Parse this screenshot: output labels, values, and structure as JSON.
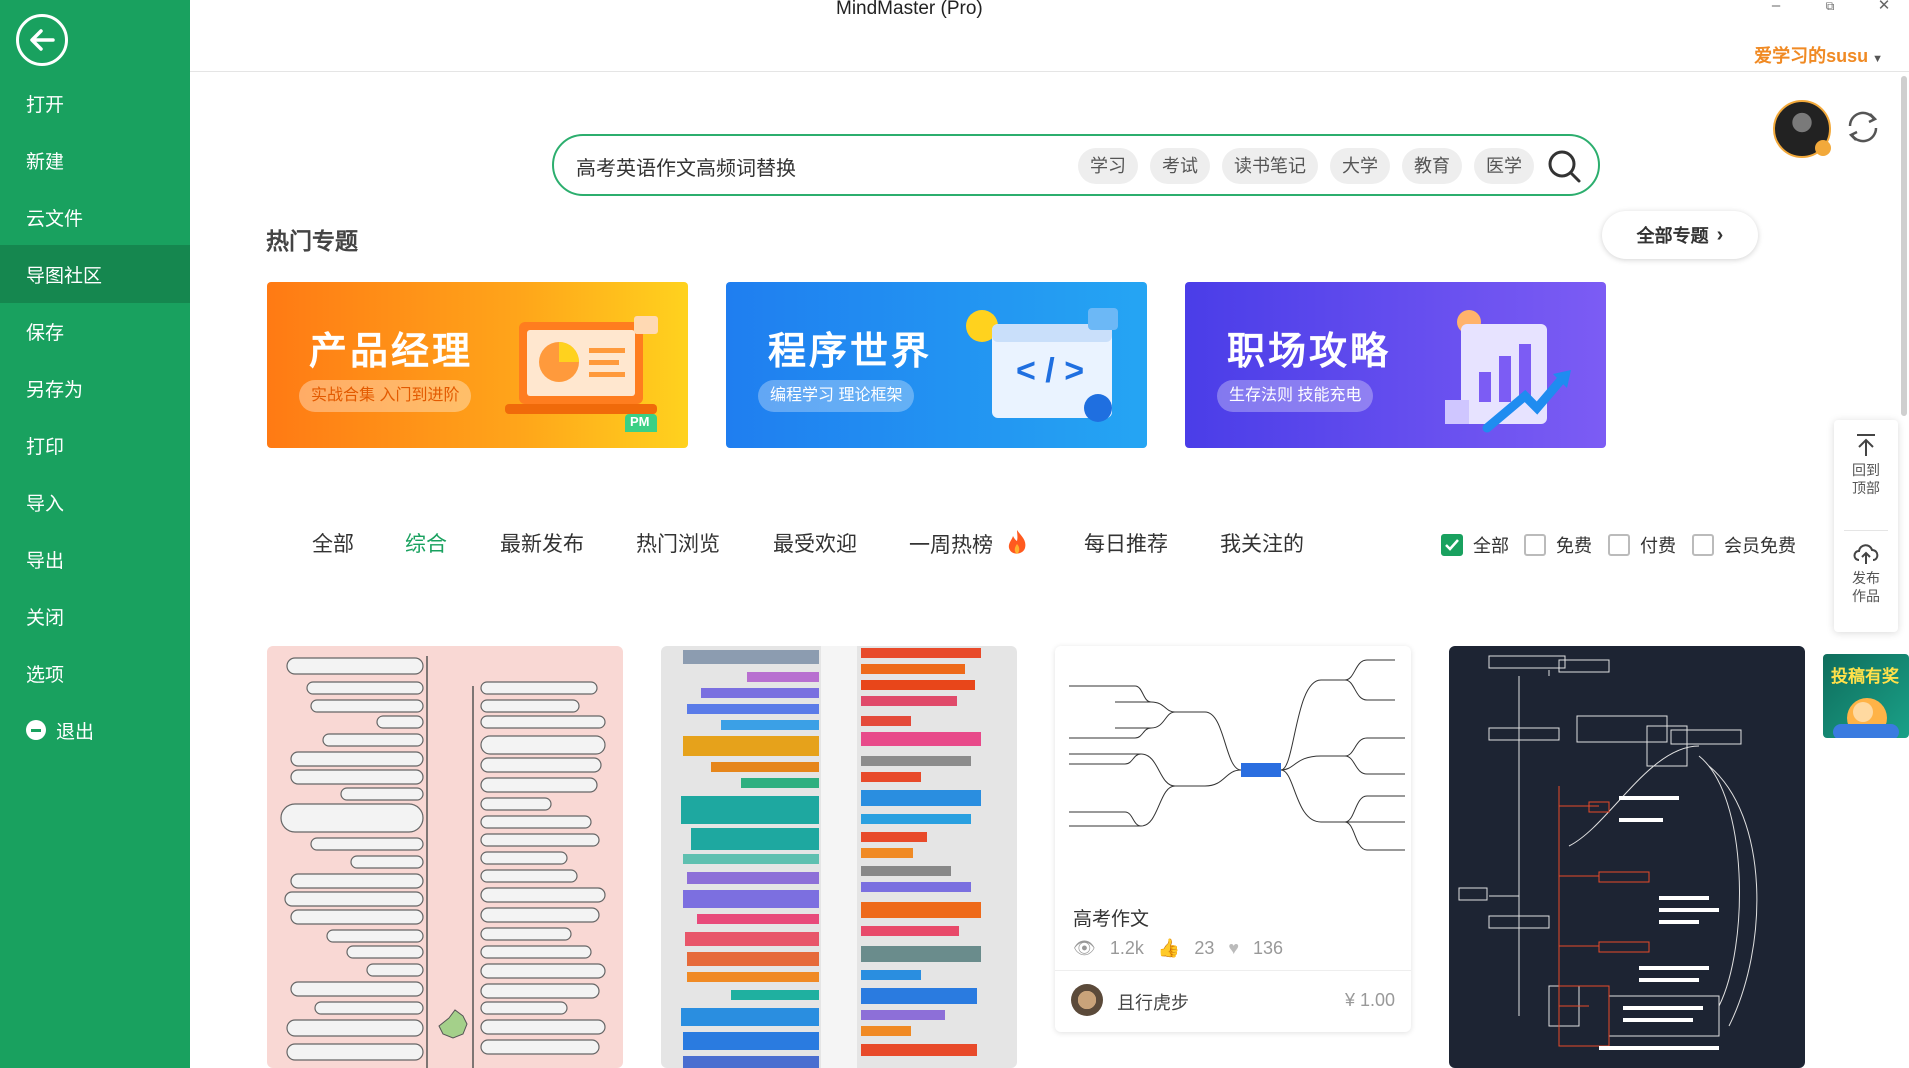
{
  "window": {
    "title": "MindMaster (Pro)",
    "minimize": "–",
    "restore": "⧉",
    "close": "✕"
  },
  "user": {
    "name": "爱学习的susu"
  },
  "sidebar": {
    "items": [
      {
        "label": "打开"
      },
      {
        "label": "新建"
      },
      {
        "label": "云文件"
      },
      {
        "label": "导图社区"
      },
      {
        "label": "保存"
      },
      {
        "label": "另存为"
      },
      {
        "label": "打印"
      },
      {
        "label": "导入"
      },
      {
        "label": "导出"
      },
      {
        "label": "关闭"
      },
      {
        "label": "选项"
      },
      {
        "label": "退出"
      }
    ]
  },
  "search": {
    "value": "高考英语作文高频词替换",
    "chips": [
      "学习",
      "考试",
      "读书笔记",
      "大学",
      "教育",
      "医学"
    ]
  },
  "hot_topics": {
    "title": "热门专题",
    "all_label": "全部专题",
    "banners": [
      {
        "title": "产品经理",
        "subtitle": "实战合集 入门到进阶",
        "badge": "PM"
      },
      {
        "title": "程序世界",
        "subtitle": "编程学习 理论框架",
        "code": "< / >"
      },
      {
        "title": "职场攻略",
        "subtitle": "生存法则 技能充电"
      }
    ]
  },
  "tabs": [
    "全部",
    "综合",
    "最新发布",
    "热门浏览",
    "最受欢迎",
    "一周热榜",
    "每日推荐",
    "我关注的"
  ],
  "active_tab": "综合",
  "filters": [
    {
      "label": "全部",
      "checked": true
    },
    {
      "label": "免费",
      "checked": false
    },
    {
      "label": "付费",
      "checked": false
    },
    {
      "label": "会员免费",
      "checked": false
    }
  ],
  "float_panel": {
    "back_top": [
      "回到",
      "顶部"
    ],
    "publish": [
      "发布",
      "作品"
    ]
  },
  "cards": [
    {
      "kind": "mindmap-pink"
    },
    {
      "kind": "mindmap-colorful"
    },
    {
      "kind": "mindmap-white",
      "title": "高考作文",
      "views": "1.2k",
      "likes": "23",
      "favorites": "136",
      "author": "且行虎步",
      "price": "¥ 1.00"
    },
    {
      "kind": "mindmap-dark"
    }
  ],
  "ad": {
    "text": "投稿有奖"
  },
  "colors": {
    "brand": "#19a15f",
    "accent": "#f08a24"
  }
}
